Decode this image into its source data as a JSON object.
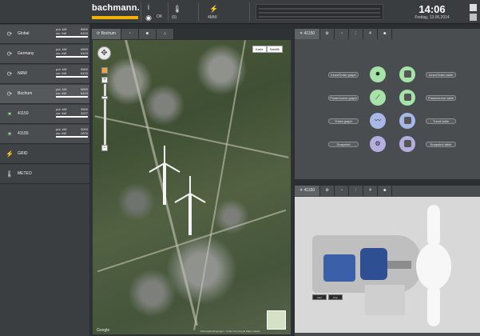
{
  "header": {
    "brand": "bachmann.",
    "time": "14:06",
    "date": "Freitag, 13.06.2014",
    "small_values": [
      "OK",
      "(0)",
      "4MW"
    ],
    "colors": {
      "brand_accent": "#f0b400",
      "topbar": "#3a3d40"
    }
  },
  "nav": {
    "items": [
      {
        "name": "Global",
        "icon": "turbine-icon",
        "stats": [
          [
            "pot. kW",
            "6500"
          ],
          [
            "cur. kW",
            "6103"
          ]
        ]
      },
      {
        "name": "Germany",
        "icon": "turbine-icon",
        "stats": [
          [
            "pot. kW",
            "6500"
          ],
          [
            "cur. kW",
            "6103"
          ]
        ]
      },
      {
        "name": "NRW",
        "icon": "turbine-icon",
        "stats": [
          [
            "pot. kW",
            "6500"
          ],
          [
            "cur. kW",
            "6103"
          ]
        ]
      },
      {
        "name": "Bochum",
        "icon": "turbine-icon",
        "stats": [
          [
            "pot. kW",
            "6500"
          ],
          [
            "cur. kW",
            "6103"
          ]
        ]
      },
      {
        "name": "41150",
        "icon": "wind-turbine-icon",
        "stats": [
          [
            "pot. kW",
            "3500"
          ],
          [
            "cur. kW",
            "3227"
          ]
        ]
      },
      {
        "name": "41155",
        "icon": "wind-turbine-icon",
        "stats": [
          [
            "pot. kW",
            "3000"
          ],
          [
            "cur. kW",
            "2876"
          ]
        ]
      },
      {
        "name": "GRID",
        "icon": "lightning-icon",
        "stats": []
      },
      {
        "name": "METEO",
        "icon": "thermometer-icon",
        "stats": []
      }
    ]
  },
  "map_panel": {
    "tab_title": "Bochum",
    "map_type": [
      "Karte",
      "Satellit"
    ],
    "provider": "Google",
    "terms": "Nutzungsbedingungen · Fehler bei Google Maps melden"
  },
  "status_panel": {
    "tab_title": "41150",
    "rows": [
      {
        "left": "Inner/Outer graph",
        "right": "Inner/Outer table",
        "left_circle": "star",
        "right_circle": "square",
        "left_color": "green",
        "right_color": "green"
      },
      {
        "left": "Power/curve graph",
        "right": "Power/curve table",
        "left_circle": "curve",
        "right_circle": "square",
        "left_color": "green",
        "right_color": "green"
      },
      {
        "left": "Trend graph",
        "right": "Trend table",
        "left_circle": "trend",
        "right_circle": "square",
        "left_color": "blue",
        "right_color": "blue"
      },
      {
        "left": "Snapshot",
        "right": "Snapshot table",
        "left_circle": "gears",
        "right_circle": "square",
        "left_color": "purple",
        "right_color": "purple"
      }
    ]
  },
  "nacelle_panel": {
    "tab_title": "41150",
    "inputs": [
      "Start",
      "Stop"
    ]
  }
}
